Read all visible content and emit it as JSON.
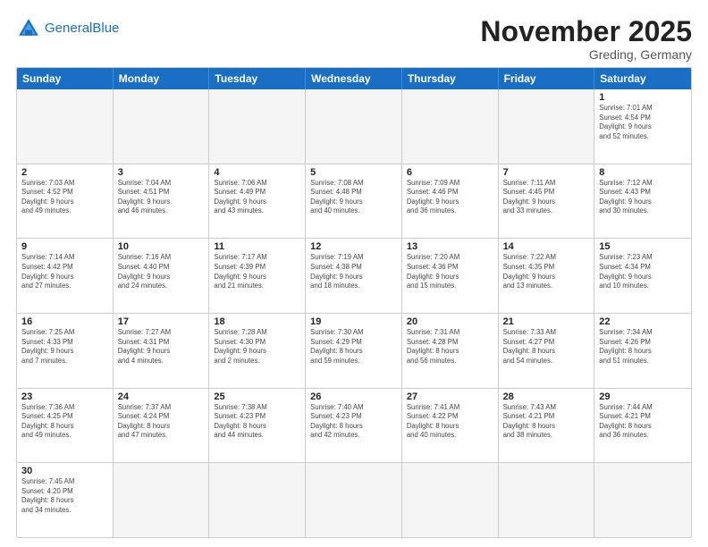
{
  "header": {
    "logo_general": "General",
    "logo_blue": "Blue",
    "month_title": "November 2025",
    "location": "Greding, Germany"
  },
  "days_of_week": [
    "Sunday",
    "Monday",
    "Tuesday",
    "Wednesday",
    "Thursday",
    "Friday",
    "Saturday"
  ],
  "weeks": [
    [
      {
        "day": "",
        "info": "",
        "empty": true
      },
      {
        "day": "",
        "info": "",
        "empty": true
      },
      {
        "day": "",
        "info": "",
        "empty": true
      },
      {
        "day": "",
        "info": "",
        "empty": true
      },
      {
        "day": "",
        "info": "",
        "empty": true
      },
      {
        "day": "",
        "info": "",
        "empty": true
      },
      {
        "day": "1",
        "info": "Sunrise: 7:01 AM\nSunset: 4:54 PM\nDaylight: 9 hours\nand 52 minutes."
      }
    ],
    [
      {
        "day": "2",
        "info": "Sunrise: 7:03 AM\nSunset: 4:52 PM\nDaylight: 9 hours\nand 49 minutes."
      },
      {
        "day": "3",
        "info": "Sunrise: 7:04 AM\nSunset: 4:51 PM\nDaylight: 9 hours\nand 46 minutes."
      },
      {
        "day": "4",
        "info": "Sunrise: 7:06 AM\nSunset: 4:49 PM\nDaylight: 9 hours\nand 43 minutes."
      },
      {
        "day": "5",
        "info": "Sunrise: 7:08 AM\nSunset: 4:48 PM\nDaylight: 9 hours\nand 40 minutes."
      },
      {
        "day": "6",
        "info": "Sunrise: 7:09 AM\nSunset: 4:46 PM\nDaylight: 9 hours\nand 36 minutes."
      },
      {
        "day": "7",
        "info": "Sunrise: 7:11 AM\nSunset: 4:45 PM\nDaylight: 9 hours\nand 33 minutes."
      },
      {
        "day": "8",
        "info": "Sunrise: 7:12 AM\nSunset: 4:43 PM\nDaylight: 9 hours\nand 30 minutes."
      }
    ],
    [
      {
        "day": "9",
        "info": "Sunrise: 7:14 AM\nSunset: 4:42 PM\nDaylight: 9 hours\nand 27 minutes."
      },
      {
        "day": "10",
        "info": "Sunrise: 7:16 AM\nSunset: 4:40 PM\nDaylight: 9 hours\nand 24 minutes."
      },
      {
        "day": "11",
        "info": "Sunrise: 7:17 AM\nSunset: 4:39 PM\nDaylight: 9 hours\nand 21 minutes."
      },
      {
        "day": "12",
        "info": "Sunrise: 7:19 AM\nSunset: 4:38 PM\nDaylight: 9 hours\nand 18 minutes."
      },
      {
        "day": "13",
        "info": "Sunrise: 7:20 AM\nSunset: 4:36 PM\nDaylight: 9 hours\nand 15 minutes."
      },
      {
        "day": "14",
        "info": "Sunrise: 7:22 AM\nSunset: 4:35 PM\nDaylight: 9 hours\nand 13 minutes."
      },
      {
        "day": "15",
        "info": "Sunrise: 7:23 AM\nSunset: 4:34 PM\nDaylight: 9 hours\nand 10 minutes."
      }
    ],
    [
      {
        "day": "16",
        "info": "Sunrise: 7:25 AM\nSunset: 4:33 PM\nDaylight: 9 hours\nand 7 minutes."
      },
      {
        "day": "17",
        "info": "Sunrise: 7:27 AM\nSunset: 4:31 PM\nDaylight: 9 hours\nand 4 minutes."
      },
      {
        "day": "18",
        "info": "Sunrise: 7:28 AM\nSunset: 4:30 PM\nDaylight: 9 hours\nand 2 minutes."
      },
      {
        "day": "19",
        "info": "Sunrise: 7:30 AM\nSunset: 4:29 PM\nDaylight: 8 hours\nand 59 minutes."
      },
      {
        "day": "20",
        "info": "Sunrise: 7:31 AM\nSunset: 4:28 PM\nDaylight: 8 hours\nand 56 minutes."
      },
      {
        "day": "21",
        "info": "Sunrise: 7:33 AM\nSunset: 4:27 PM\nDaylight: 8 hours\nand 54 minutes."
      },
      {
        "day": "22",
        "info": "Sunrise: 7:34 AM\nSunset: 4:26 PM\nDaylight: 8 hours\nand 51 minutes."
      }
    ],
    [
      {
        "day": "23",
        "info": "Sunrise: 7:36 AM\nSunset: 4:25 PM\nDaylight: 8 hours\nand 49 minutes."
      },
      {
        "day": "24",
        "info": "Sunrise: 7:37 AM\nSunset: 4:24 PM\nDaylight: 8 hours\nand 47 minutes."
      },
      {
        "day": "25",
        "info": "Sunrise: 7:38 AM\nSunset: 4:23 PM\nDaylight: 8 hours\nand 44 minutes."
      },
      {
        "day": "26",
        "info": "Sunrise: 7:40 AM\nSunset: 4:23 PM\nDaylight: 8 hours\nand 42 minutes."
      },
      {
        "day": "27",
        "info": "Sunrise: 7:41 AM\nSunset: 4:22 PM\nDaylight: 8 hours\nand 40 minutes."
      },
      {
        "day": "28",
        "info": "Sunrise: 7:43 AM\nSunset: 4:21 PM\nDaylight: 8 hours\nand 38 minutes."
      },
      {
        "day": "29",
        "info": "Sunrise: 7:44 AM\nSunset: 4:21 PM\nDaylight: 8 hours\nand 36 minutes."
      }
    ],
    [
      {
        "day": "30",
        "info": "Sunrise: 7:45 AM\nSunset: 4:20 PM\nDaylight: 8 hours\nand 34 minutes."
      },
      {
        "day": "",
        "info": "",
        "empty": true
      },
      {
        "day": "",
        "info": "",
        "empty": true
      },
      {
        "day": "",
        "info": "",
        "empty": true
      },
      {
        "day": "",
        "info": "",
        "empty": true
      },
      {
        "day": "",
        "info": "",
        "empty": true
      },
      {
        "day": "",
        "info": "",
        "empty": true
      }
    ]
  ]
}
